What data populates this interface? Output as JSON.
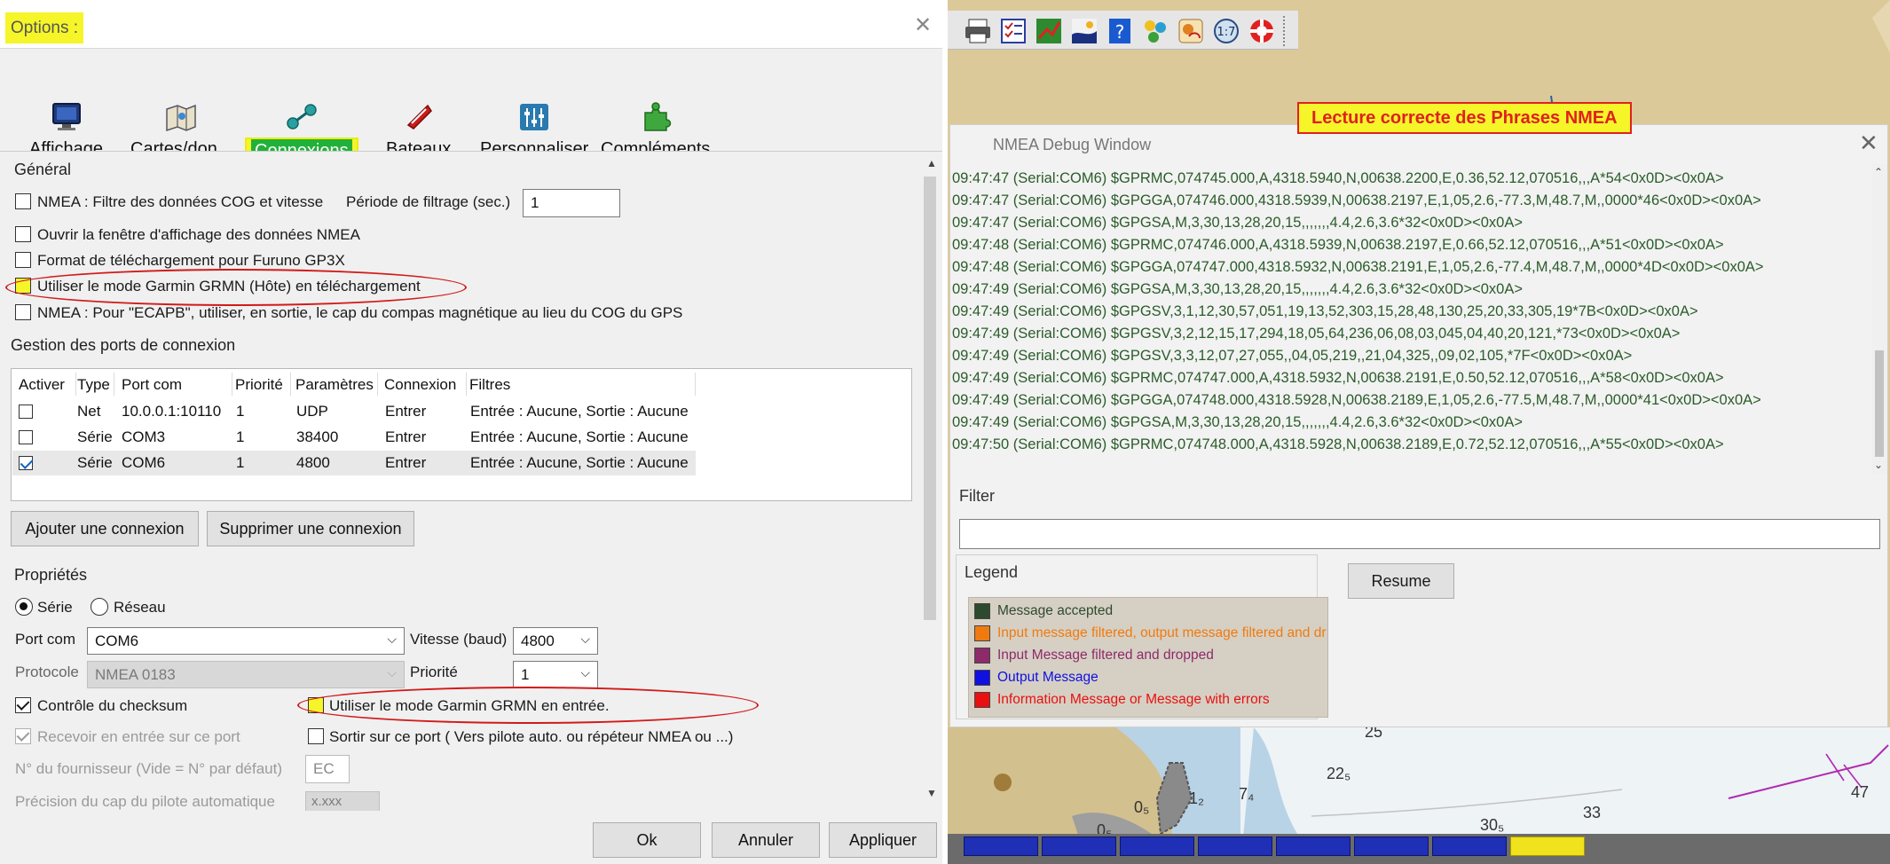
{
  "options": {
    "title": "Options :",
    "close_glyph": "✕",
    "categories": [
      {
        "label": "Affichage",
        "icon": "monitor-icon"
      },
      {
        "label": "Cartes/don...",
        "icon": "charts-icon"
      },
      {
        "label": "Connexions",
        "icon": "connections-icon"
      },
      {
        "label": "Bateaux",
        "icon": "boat-icon"
      },
      {
        "label": "Personnaliser",
        "icon": "sliders-icon"
      },
      {
        "label": "Compléments",
        "icon": "plugin-icon"
      }
    ],
    "active_category": "Connexions",
    "general": {
      "title": "Général",
      "cog_filter_label": "NMEA : Filtre des données COG et vitesse",
      "cog_filter_checked": false,
      "period_label": "Période de filtrage (sec.)",
      "period_value": "1",
      "open_nmea_window_label": "Ouvrir la fenêtre d'affichage des données NMEA",
      "open_nmea_window_checked": false,
      "furuno_label": "Format de téléchargement pour Furuno GP3X",
      "furuno_checked": false,
      "garmin_host_label": "Utiliser le mode Garmin GRMN (Hôte) en téléchargement",
      "garmin_host_checked": false,
      "ecapb_label": "NMEA : Pour \"ECAPB\", utiliser, en sortie, le cap du compas magnétique  au lieu du COG du GPS",
      "ecapb_checked": false
    },
    "ports": {
      "title": "Gestion des ports de connexion",
      "columns": [
        "Activer",
        "Type",
        "Port com",
        "Priorité",
        "Paramètres",
        "Connexion",
        "Filtres"
      ],
      "rows": [
        {
          "enabled": false,
          "type": "Net",
          "port": "10.0.0.1:10110",
          "priority": "1",
          "params": "UDP",
          "connection": "Entrer",
          "filters": "Entrée : Aucune, Sortie : Aucune"
        },
        {
          "enabled": false,
          "type": "Série",
          "port": "COM3",
          "priority": "1",
          "params": "38400",
          "connection": "Entrer",
          "filters": "Entrée : Aucune, Sortie : Aucune"
        },
        {
          "enabled": true,
          "type": "Série",
          "port": "COM6",
          "priority": "1",
          "params": "4800",
          "connection": "Entrer",
          "filters": "Entrée : Aucune, Sortie : Aucune"
        }
      ],
      "add_button": "Ajouter une connexion",
      "remove_button": "Supprimer une connexion"
    },
    "properties": {
      "title": "Propriétés",
      "serial_label": "Série",
      "network_label": "Réseau",
      "selected_mode": "Série",
      "port_label": "Port com",
      "port_value": "COM6",
      "baud_label": "Vitesse (baud)",
      "baud_value": "4800",
      "protocol_label": "Protocole",
      "protocol_value": "NMEA 0183",
      "priority_label": "Priorité",
      "priority_value": "1",
      "checksum_label": "Contrôle du checksum",
      "checksum_checked": true,
      "garmin_input_label": "Utiliser le mode Garmin GRMN en entrée.",
      "garmin_input_checked": false,
      "receive_label": "Recevoir en entrée sur ce port",
      "receive_checked": true,
      "output_label": "Sortir sur ce port ( Vers pilote auto. ou répéteur NMEA ou ...)",
      "output_checked": false,
      "supplier_label": "N° du fournisseur (Vide = N° par défaut)",
      "supplier_value": "EC",
      "autopilot_label": "Précision du cap du pilote automatique",
      "autopilot_value": "x.xxx"
    },
    "buttons": {
      "ok": "Ok",
      "cancel": "Annuler",
      "apply": "Appliquer"
    }
  },
  "nmea_window": {
    "title": "NMEA Debug Window",
    "close_glyph": "✕",
    "annotation": "Lecture correcte des Phrases NMEA",
    "log": [
      "09:47:47 (Serial:COM6) $GPRMC,074745.000,A,4318.5940,N,00638.2200,E,0.36,52.12,070516,,,A*54<0x0D><0x0A>",
      "09:47:47 (Serial:COM6) $GPGGA,074746.000,4318.5939,N,00638.2197,E,1,05,2.6,-77.3,M,48.7,M,,0000*46<0x0D><0x0A>",
      "09:47:47 (Serial:COM6) $GPGSA,M,3,30,13,28,20,15,,,,,,,4.4,2.6,3.6*32<0x0D><0x0A>",
      "09:47:48 (Serial:COM6) $GPRMC,074746.000,A,4318.5939,N,00638.2197,E,0.66,52.12,070516,,,A*51<0x0D><0x0A>",
      "09:47:48 (Serial:COM6) $GPGGA,074747.000,4318.5932,N,00638.2191,E,1,05,2.6,-77.4,M,48.7,M,,0000*4D<0x0D><0x0A>",
      "09:47:49 (Serial:COM6) $GPGSA,M,3,30,13,28,20,15,,,,,,,4.4,2.6,3.6*32<0x0D><0x0A>",
      "09:47:49 (Serial:COM6) $GPGSV,3,1,12,30,57,051,19,13,52,303,15,28,48,130,25,20,33,305,19*7B<0x0D><0x0A>",
      "09:47:49 (Serial:COM6) $GPGSV,3,2,12,15,17,294,18,05,64,236,06,08,03,045,04,40,20,121,*73<0x0D><0x0A>",
      "09:47:49 (Serial:COM6) $GPGSV,3,3,12,07,27,055,,04,05,219,,21,04,325,,09,02,105,*7F<0x0D><0x0A>",
      "09:47:49 (Serial:COM6) $GPRMC,074747.000,A,4318.5932,N,00638.2191,E,0.50,52.12,070516,,,A*58<0x0D><0x0A>",
      "09:47:49 (Serial:COM6) $GPGGA,074748.000,4318.5928,N,00638.2189,E,1,05,2.6,-77.5,M,48.7,M,,0000*41<0x0D><0x0A>",
      "09:47:49 (Serial:COM6) $GPGSA,M,3,30,13,28,20,15,,,,,,,4.4,2.6,3.6*32<0x0D><0x0A>",
      "09:47:50 (Serial:COM6) $GPRMC,074748.000,A,4318.5928,N,00638.2189,E,0.72,52.12,070516,,,A*55<0x0D><0x0A>"
    ],
    "filter_label": "Filter",
    "filter_value": "",
    "legend_label": "Legend",
    "legend": [
      {
        "label": "Message accepted",
        "swatch": "#2e4a2e",
        "text_color": "#2e4a2e"
      },
      {
        "label": "Input message filtered, output message filtered and dr",
        "swatch": "#f07a10",
        "text_color": "#f07a10"
      },
      {
        "label": "Input Message filtered and dropped",
        "swatch": "#8e2a6a",
        "text_color": "#8e2a6a"
      },
      {
        "label": "Output Message",
        "swatch": "#1010e0",
        "text_color": "#1010e0"
      },
      {
        "label": "Information Message or Message with errors",
        "swatch": "#e81010",
        "text_color": "#e81010"
      }
    ],
    "resume_button": "Resume"
  },
  "chart": {
    "depth_labels": [
      "22₅",
      "7₄",
      "33",
      "30₅",
      "47",
      "1₂",
      "0₅",
      "0₅",
      "25"
    ]
  }
}
